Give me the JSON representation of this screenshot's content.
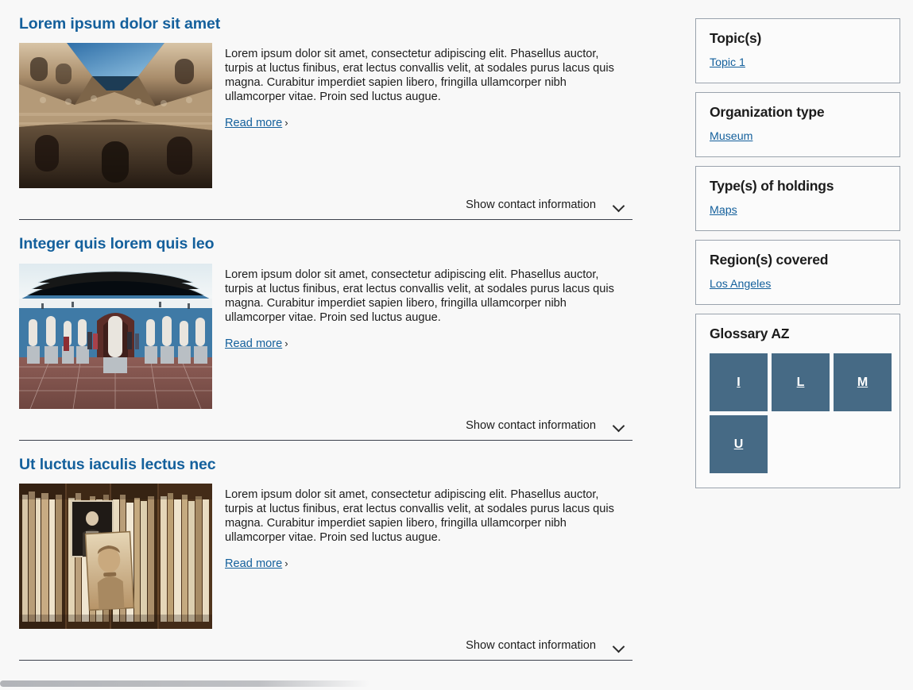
{
  "articles": [
    {
      "title": "Lorem ipsum dolor sit amet",
      "body": "Lorem ipsum dolor sit amet, consectetur adipiscing elit. Phasellus auctor, turpis at luctus finibus, erat lectus convallis velit, at sodales purus lacus quis magna. Curabitur imperdiet sapien libero, fringilla ullamcorper nibh ullamcorper vitae. Proin sed luctus augue.",
      "read_more": "Read more",
      "contact_toggle": "Show contact information",
      "image_alt": "moorish-courtyard-photo"
    },
    {
      "title": "Integer quis lorem quis leo",
      "body": "Lorem ipsum dolor sit amet, consectetur adipiscing elit. Phasellus auctor, turpis at luctus finibus, erat lectus convallis velit, at sodales purus lacus quis magna. Curabitur imperdiet sapien libero, fringilla ullamcorper nibh ullamcorper vitae. Proin sed luctus augue.",
      "read_more": "Read more",
      "contact_toggle": "Show contact information",
      "image_alt": "sculpture-gallery-photo"
    },
    {
      "title": "Ut luctus iaculis lectus nec",
      "body": "Lorem ipsum dolor sit amet, consectetur adipiscing elit. Phasellus auctor, turpis at luctus finibus, erat lectus convallis velit, at sodales purus lacus quis magna. Curabitur imperdiet sapien libero, fringilla ullamcorper nibh ullamcorper vitae. Proin sed luctus augue.",
      "read_more": "Read more",
      "contact_toggle": "Show contact information",
      "image_alt": "vintage-photographs-photo"
    }
  ],
  "sidebar": {
    "facets": [
      {
        "title": "Topic(s)",
        "value": "Topic 1"
      },
      {
        "title": "Organization type",
        "value": "Museum"
      },
      {
        "title": "Type(s) of holdings",
        "value": "Maps"
      },
      {
        "title": "Region(s) covered",
        "value": "Los Angeles"
      }
    ],
    "glossary": {
      "title": "Glossary AZ",
      "letters": [
        "I",
        "L",
        "M",
        "U"
      ]
    }
  },
  "icons": {
    "read_more_chevron": "chevron-right-icon",
    "contact_chevron": "chevron-down-icon"
  },
  "colors": {
    "link": "#14609c",
    "heading": "#14609c",
    "text": "#1c1c1c",
    "facet_border": "#9aa3ad",
    "glossary_tile": "#466a85",
    "divider": "#3c414c",
    "background": "#f8f8f8"
  }
}
